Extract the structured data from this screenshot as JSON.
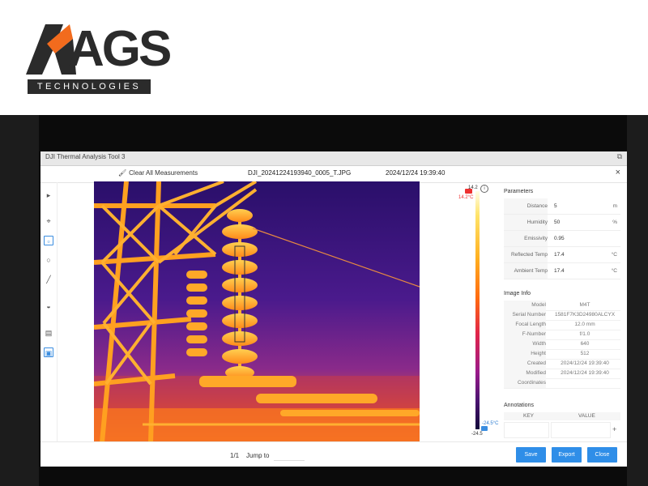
{
  "logo": {
    "mark": "AGS",
    "tagline": "TECHNOLOGIES"
  },
  "app": {
    "window_title": "DJI Thermal Analysis Tool 3",
    "clear_all": "Clear All Measurements",
    "filename": "DJI_20241224193940_0005_T.JPG",
    "datetime": "2024/12/24 19:39:40"
  },
  "scale": {
    "max": "14.2",
    "max_marker": "14.2°C",
    "min": "-24.5",
    "min_marker": "-24.5°C"
  },
  "parameters": {
    "title": "Parameters",
    "rows": [
      {
        "label": "Distance",
        "value": "5",
        "unit": "m"
      },
      {
        "label": "Humidity",
        "value": "50",
        "unit": "%"
      },
      {
        "label": "Emissivity",
        "value": "0.95",
        "unit": ""
      },
      {
        "label": "Reflected Temp",
        "value": "17.4",
        "unit": "°C"
      },
      {
        "label": "Ambient Temp",
        "value": "17.4",
        "unit": "°C"
      }
    ]
  },
  "image_info": {
    "title": "Image Info",
    "rows": [
      {
        "label": "Model",
        "value": "M4T"
      },
      {
        "label": "Serial Number",
        "value": "1581F7K3D24980ALCYX"
      },
      {
        "label": "Focal Length",
        "value": "12.0 mm"
      },
      {
        "label": "F-Number",
        "value": "f/1.0"
      },
      {
        "label": "Width",
        "value": "640"
      },
      {
        "label": "Height",
        "value": "512"
      },
      {
        "label": "Created",
        "value": "2024/12/24 19:39:40"
      },
      {
        "label": "Modified",
        "value": "2024/12/24 19:39:40"
      },
      {
        "label": "Coordinates",
        "value": ""
      }
    ]
  },
  "annotations": {
    "title": "Annotations",
    "key": "KEY",
    "value": "VALUE",
    "add": "+"
  },
  "footer": {
    "page": "1/1",
    "jump": "Jump to",
    "save": "Save",
    "export": "Export",
    "close": "Close"
  },
  "icons": {
    "pointer": "pointer-icon",
    "spot": "spot-icon",
    "box": "box-icon",
    "circle": "circle-icon",
    "line": "line-icon",
    "palette": "palette-icon",
    "compare": "compare-icon",
    "image": "image-icon"
  }
}
